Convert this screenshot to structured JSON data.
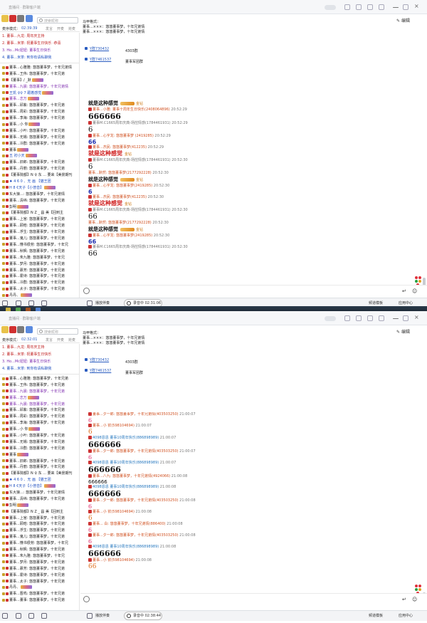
{
  "app": {
    "title": "直播间 · 群聊客户端"
  },
  "colors": {
    "accent": "#2a5cc0",
    "meta_name": "#d05020",
    "blue_text": "#2030b0",
    "red_text": "#d02020"
  },
  "search": {
    "placeholder": "搜索昵称"
  },
  "top": {
    "mode": {
      "label": "麦序模式：",
      "time": "02:39:39",
      "tabs": [
        "发言",
        "开麦",
        "抢麦"
      ]
    },
    "pinned": [
      {
        "num": "1.",
        "text": "董事...九龙: 周年庆主持"
      },
      {
        "num": "2.",
        "text": "董事...米茶: 祝董事生日快乐 ·恭喜"
      },
      {
        "num": "3.",
        "text": "Ho...Mc妞妞: 董事生日快乐"
      },
      {
        "num": "4.",
        "text": "董事...米茶: 到你有请私聊我"
      }
    ],
    "users": [
      "董事...心雅雅: 悠悠董事梦，十年兄弟情",
      "董事...王伟: 悠悠董事梦，十年兄弟",
      "【董事】/ _默",
      "董事...九晨: 悠悠董事梦，十年兄弟情",
      "王凯 ♀♀ 7 跟着感觉",
      "董事...志万",
      "董事...邱紫: 悠悠董事梦，十年兄弟",
      "董事...周彩: 悠悠董事梦，十年兄弟",
      "董事...李海: 悠悠董事梦，十年兄弟",
      "董事...小 你",
      "董事...小叶: 悠悠董事梦，十年兄弟",
      "董事...无锡: 悠悠董事梦，十年兄弟",
      "董事...冷群: 悠悠董事梦，十年兄弟",
      "董事",
      "五 初小天",
      "董事...旧郎: 悠悠董事梦，十年兄弟",
      "董事...丹丽: 悠悠董事梦，十年兄弟",
      "【董事院都】N ♀ 东 ... 要来【美景期刊",
      "♠ 4 6 0 、无   画   【猫王团",
      "H 8 €天子【小普音】",
      "东大狼...: 悠悠董事梦，十年兄弟情",
      "董事...清纬: 悠悠董事梦，十年兄弟",
      "彭明",
      "【董事院都】N Z _ 昌   美【回到主",
      "董事...上官: 悠悠董事梦，十年兄弟",
      "董事...顾晗: 悠悠董事梦，十年兄弟",
      "董事...浮生: 悠悠董事梦，十年兄弟",
      "董事...鬼儿: 悠悠董事梦，十年兄弟",
      "董事...懂书很劳: 悠悠董事梦，十年兄",
      "董事...秋枫: 悠悠董事梦，十年兄弟",
      "董事...朱九雅: 悠悠董事梦，十年兄",
      "董事...梦月: 悠悠董事梦，十年兄弟",
      "董事...慕芳: 悠悠董事梦，十年兄弟",
      "董事...霍诗: 悠悠董事梦，十年兄弟",
      "董事...冷群: 悠悠董事梦，十年兄弟",
      "董事...太子: 悠悠董事梦，十年兄弟",
      "丹丹、"
    ],
    "announce": "马甲格式：\n董事...×××：悠悠董事梦，十年兄弟情\n董事...×××：悠悠董事梦，十年兄弟情",
    "links": [
      {
        "label": "Y群730432",
        "num": "4303群"
      },
      {
        "label": "Y群7461537",
        "num": "董事军团群"
      }
    ],
    "chat": [
      {
        "name": "就是这种感觉",
        "badge": true,
        "time": "",
        "body": "",
        "style": "bold-title",
        "suffix": "金钻"
      },
      {
        "name": "董事...小雅: 董事十周年生日快乐(2408064896)",
        "time": "20:52:29",
        "body": "666666",
        "style": "big"
      },
      {
        "name": "董事M.C1665周年庆典-场控情感(1784461931)",
        "time": "20:52:29",
        "body": "6",
        "style": "med"
      },
      {
        "name": "董事...心字龙: 悠悠董事梦 (2419285)",
        "time": "20:52:29",
        "body": "66",
        "style": "blue"
      },
      {
        "name": "董事...杰民: 悠悠董事梦(412235)",
        "time": "20:52:29",
        "body": "就是这种感觉",
        "style": "red",
        "suffix": "金钻"
      },
      {
        "name": "董事M.C1665周年庆典-场控情感(1784461931)",
        "time": "20:52:30",
        "body": "6",
        "style": "med"
      },
      {
        "name": "董事...默然: 悠悠董事梦(2177292228)",
        "time": "20:52:30",
        "body": "就是这种感觉",
        "style": "bold-title",
        "suffix": "金钻"
      },
      {
        "name": "董事...心字龙: 悠悠董事梦(2419285)",
        "time": "20:52:30",
        "body": "6",
        "style": "blue"
      },
      {
        "name": "董事...杰民: 悠悠董事梦(412235)",
        "time": "20:52:30",
        "body": "就是这种感觉",
        "style": "red",
        "suffix": "金钻"
      },
      {
        "name": "董事M.C1665周年庆典-场控情感(1784461931)",
        "time": "20:52:30",
        "body": "66",
        "style": "med"
      },
      {
        "name": "董事...默然: 悠悠董事梦(2177292228)",
        "time": "20:52:30",
        "body": "就是这种感觉",
        "style": "bold-title",
        "suffix": "金钻"
      },
      {
        "name": "董事...心字龙: 悠悠董事梦(2419285)",
        "time": "20:52:30",
        "body": "66",
        "style": "blue"
      },
      {
        "name": "董事M.C1665周年庆典-场控情感(1784461931)",
        "time": "20:52:30",
        "body": "66",
        "style": "med"
      }
    ],
    "taskbar": {
      "live_time": "02:31:06",
      "live_label": "录音中",
      "playlist": "播放伴奏",
      "right": "频道模板",
      "app_mode": "应用中心"
    }
  },
  "bottom": {
    "mode": {
      "label": "麦序模式：",
      "time": "02:32:01",
      "tabs": [
        "发言",
        "开麦",
        "抢麦"
      ]
    },
    "pinned": [
      {
        "num": "1.",
        "text": "董事...九龙: 周年庆主持"
      },
      {
        "num": "2.",
        "text": "董事...米茶: 祝董事生日快乐"
      },
      {
        "num": "3.",
        "text": "Ho...Mc妞妞: 董事生日快乐"
      },
      {
        "num": "4.",
        "text": "董事...米茶: 到你有请私聊我"
      }
    ],
    "users": [
      "董事...心雅雅: 悠悠董事梦，十年兄弟",
      "董事...王伟: 悠悠董事梦，十年兄弟",
      "董事...九晨: 悠悠董事梦，十年兄弟",
      "董事...志万",
      "董事...九晨: 悠悠董事梦，十年兄弟",
      "董事...邱紫: 悠悠董事梦，十年兄弟",
      "董事...周彩: 悠悠董事梦，十年兄弟",
      "董事...李海: 悠悠董事梦，十年兄弟",
      "董事...小 你",
      "董事...小叶: 悠悠董事梦，十年兄弟",
      "董事...无锡: 悠悠董事梦，十年兄弟",
      "董事...冷群: 悠悠董事梦，十年兄弟",
      "董事",
      "董事...旧郎: 悠悠董事梦，十年兄弟",
      "董事...丹丽: 悠悠董事梦，十年兄弟",
      "【董事院都】N ♀ 东 ... 要来【美景期刊",
      "♠ 4 6 0 、无   画   【猫王团",
      "H 8 €天子【小普音】",
      "东大狼...: 悠悠董事梦，十年兄弟情",
      "董事...清纬: 悠悠董事梦，十年兄弟",
      "彭明",
      "【董事院都】N Z _ 昌   美【回到主",
      "董事...上官: 悠悠董事梦，十年兄弟",
      "董事...顾晗: 悠悠董事梦，十年兄弟",
      "董事...浮生: 悠悠董事梦，十年兄弟",
      "董事...鬼儿: 悠悠董事梦，十年兄弟",
      "董事...懂书很劳: 悠悠董事梦，十年兄",
      "董事...秋枫: 悠悠董事梦，十年兄弟",
      "董事...朱九雅: 悠悠董事梦，十年兄",
      "董事...梦月: 悠悠董事梦，十年兄弟",
      "董事...慕芳: 悠悠董事梦，十年兄弟",
      "董事...霍诗: 悠悠董事梦，十年兄弟",
      "董事...太子: 悠悠董事梦，十年兄弟",
      "丹丹、",
      "董事...晋鸣: 悠悠董事梦，十年兄弟",
      "董事...董事: 悠悠董事梦，十年兄弟"
    ],
    "chat": [
      {
        "name": "董事...夕一郎: 悠悠董事梦，十年兄弟情(403503250)",
        "time": "21:00:07",
        "body": "6",
        "style": "pink"
      },
      {
        "name": "董事...小 钦(598104694)",
        "time": "21:00:07",
        "body": "6",
        "style": "orange"
      },
      {
        "name": "4098恩恩 董事10周年快乐(886898989)",
        "time": "21:00:07",
        "body": "666666",
        "style": "big"
      },
      {
        "name": "董事...夕一郎: 悠悠董事梦，十年兄弟情(403503250)",
        "time": "21:00:07",
        "body": "6",
        "style": "pink"
      },
      {
        "name": "4098恩恩 董事10周年快乐(886898989)",
        "time": "21:00:07",
        "body": "666666",
        "style": "big"
      },
      {
        "name": "董事...八九: 悠悠董事梦，十年兄弟情(4924066)",
        "time": "21:00:08",
        "body": "666666",
        "style": "small"
      },
      {
        "name": "4098恩恩 董事10周年快乐(886898989)",
        "time": "21:00:08",
        "body": "666666",
        "style": "big"
      },
      {
        "name": "董事...夕一郎: 悠悠董事梦，十年兄弟情(403503250)",
        "time": "21:00:08",
        "body": "6",
        "style": "pink"
      },
      {
        "name": "董事...小 钦(598104694)",
        "time": "21:00:08",
        "body": "6",
        "style": "orange"
      },
      {
        "name": "董事... 白: 悠悠董事梦，十年兄弟情(886400)",
        "time": "21:00:08",
        "body": "6",
        "style": "pink"
      },
      {
        "name": "董事...夕一郎: 悠悠董事梦，十年兄弟情(403503250)",
        "time": "21:00:08",
        "body": "6",
        "style": "pink"
      },
      {
        "name": "4098恩恩 董事10周年快乐(886898989)",
        "time": "21:00:08",
        "body": "666666",
        "style": "big"
      },
      {
        "name": "董事...小 钦(598104694)",
        "time": "21:00:08",
        "body": "66",
        "style": "orange"
      }
    ],
    "taskbar": {
      "live_time": "02:38:44",
      "live_label": "录音中",
      "playlist": "播放伴奏",
      "right": "频道模板",
      "app_mode": "应用中心"
    }
  },
  "edit_label": "编辑",
  "send_glyph": "↵",
  "icons": [
    "search-icon",
    "edit-icon",
    "emoji-icon",
    "send-icon",
    "settings-icon",
    "mic-icon",
    "speaker-icon",
    "playlist-icon",
    "minimize-icon",
    "close-icon"
  ]
}
